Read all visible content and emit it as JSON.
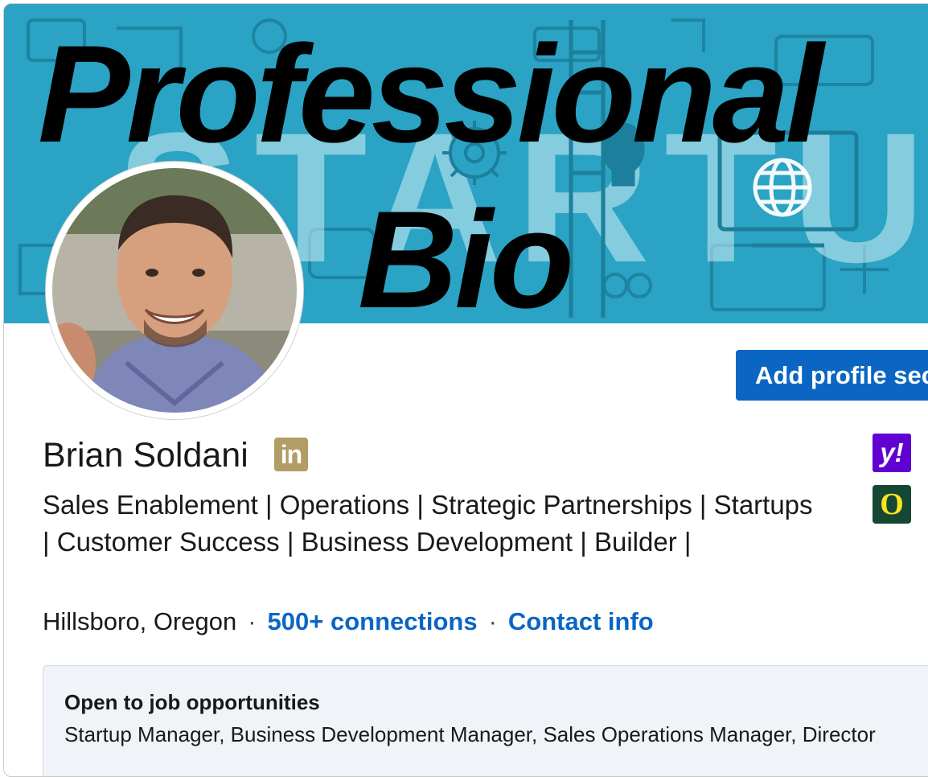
{
  "overlay": {
    "line1": "Professional",
    "line2": "Bio"
  },
  "banner": {
    "background_color": "#2aa3c4",
    "watermark_text": "STARTU",
    "icons": [
      "gear-icon",
      "globe-icon",
      "lightbulb-icon",
      "monitor-icon",
      "ladder-icon"
    ]
  },
  "profile": {
    "name": "Brian Soldani",
    "premium_badge": "in",
    "headline": "Sales Enablement | Operations | Strategic Partnerships | Startups | Customer Success | Business Development | Builder |",
    "location": "Hillsboro, Oregon",
    "separator": "·",
    "connections": "500+ connections",
    "contact": "Contact info",
    "actions": {
      "add_section": "Add profile section"
    }
  },
  "affiliations": [
    {
      "name": "yahoo-logo",
      "label": "y!",
      "color": "#6001d2"
    },
    {
      "name": "oregon-logo",
      "label": "O",
      "color": "#154733"
    }
  ],
  "open_to_work": {
    "title": "Open to job opportunities",
    "roles": "Startup Manager, Business Development Manager, Sales Operations Manager, Director"
  },
  "colors": {
    "accent": "#0a66c2",
    "premium_gold": "#b29d67"
  }
}
